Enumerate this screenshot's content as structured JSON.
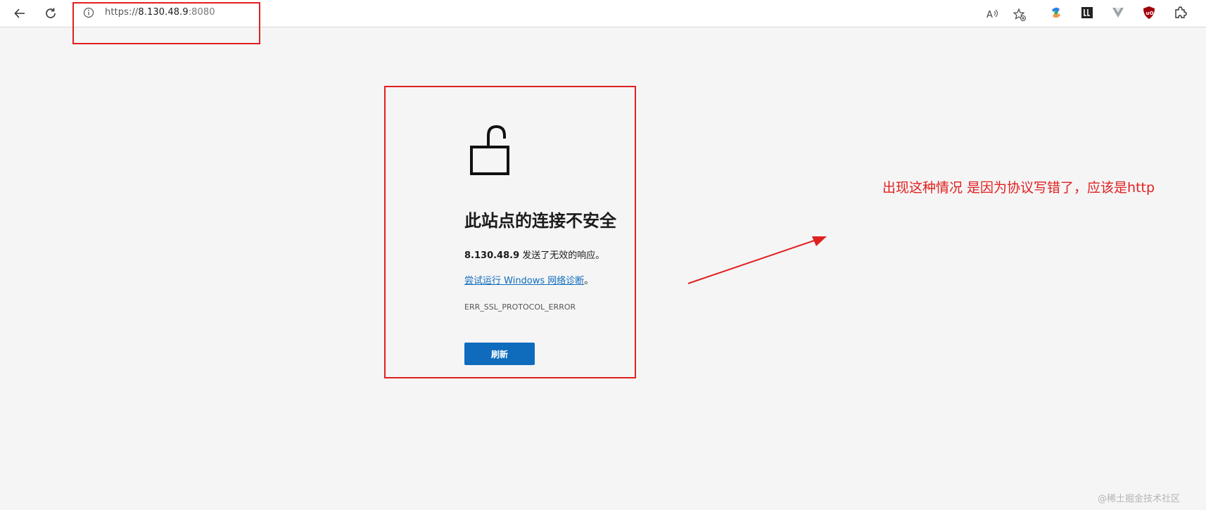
{
  "browser": {
    "back_icon": "arrow-left-icon",
    "refresh_icon": "refresh-icon",
    "site_info_icon": "info-circle-icon",
    "url": {
      "scheme": "https://",
      "host": "8.130.48.9",
      "port": ":8080"
    },
    "read_aloud_icon": "read-aloud-icon",
    "favorites_icon": "star-plus-icon",
    "extensions": [
      {
        "name": "copilot-icon"
      },
      {
        "name": "lastpass-icon"
      },
      {
        "name": "vue-devtools-icon"
      },
      {
        "name": "ublock-origin-icon"
      },
      {
        "name": "extensions-puzzle-icon"
      }
    ]
  },
  "error_page": {
    "icon": "unlocked-padlock-icon",
    "heading": "此站点的连接不安全",
    "description_host": "8.130.48.9",
    "description_text": " 发送了无效的响应。",
    "diagnose_link": "尝试运行 Windows 网络诊断",
    "diagnose_suffix": "。",
    "error_code": "ERR_SSL_PROTOCOL_ERROR",
    "refresh_label": "刷新"
  },
  "annotation": {
    "note": "出现这种情况 是因为协议写错了，应该是http",
    "color": "#e02020"
  },
  "watermark": "@稀土掘金技术社区"
}
